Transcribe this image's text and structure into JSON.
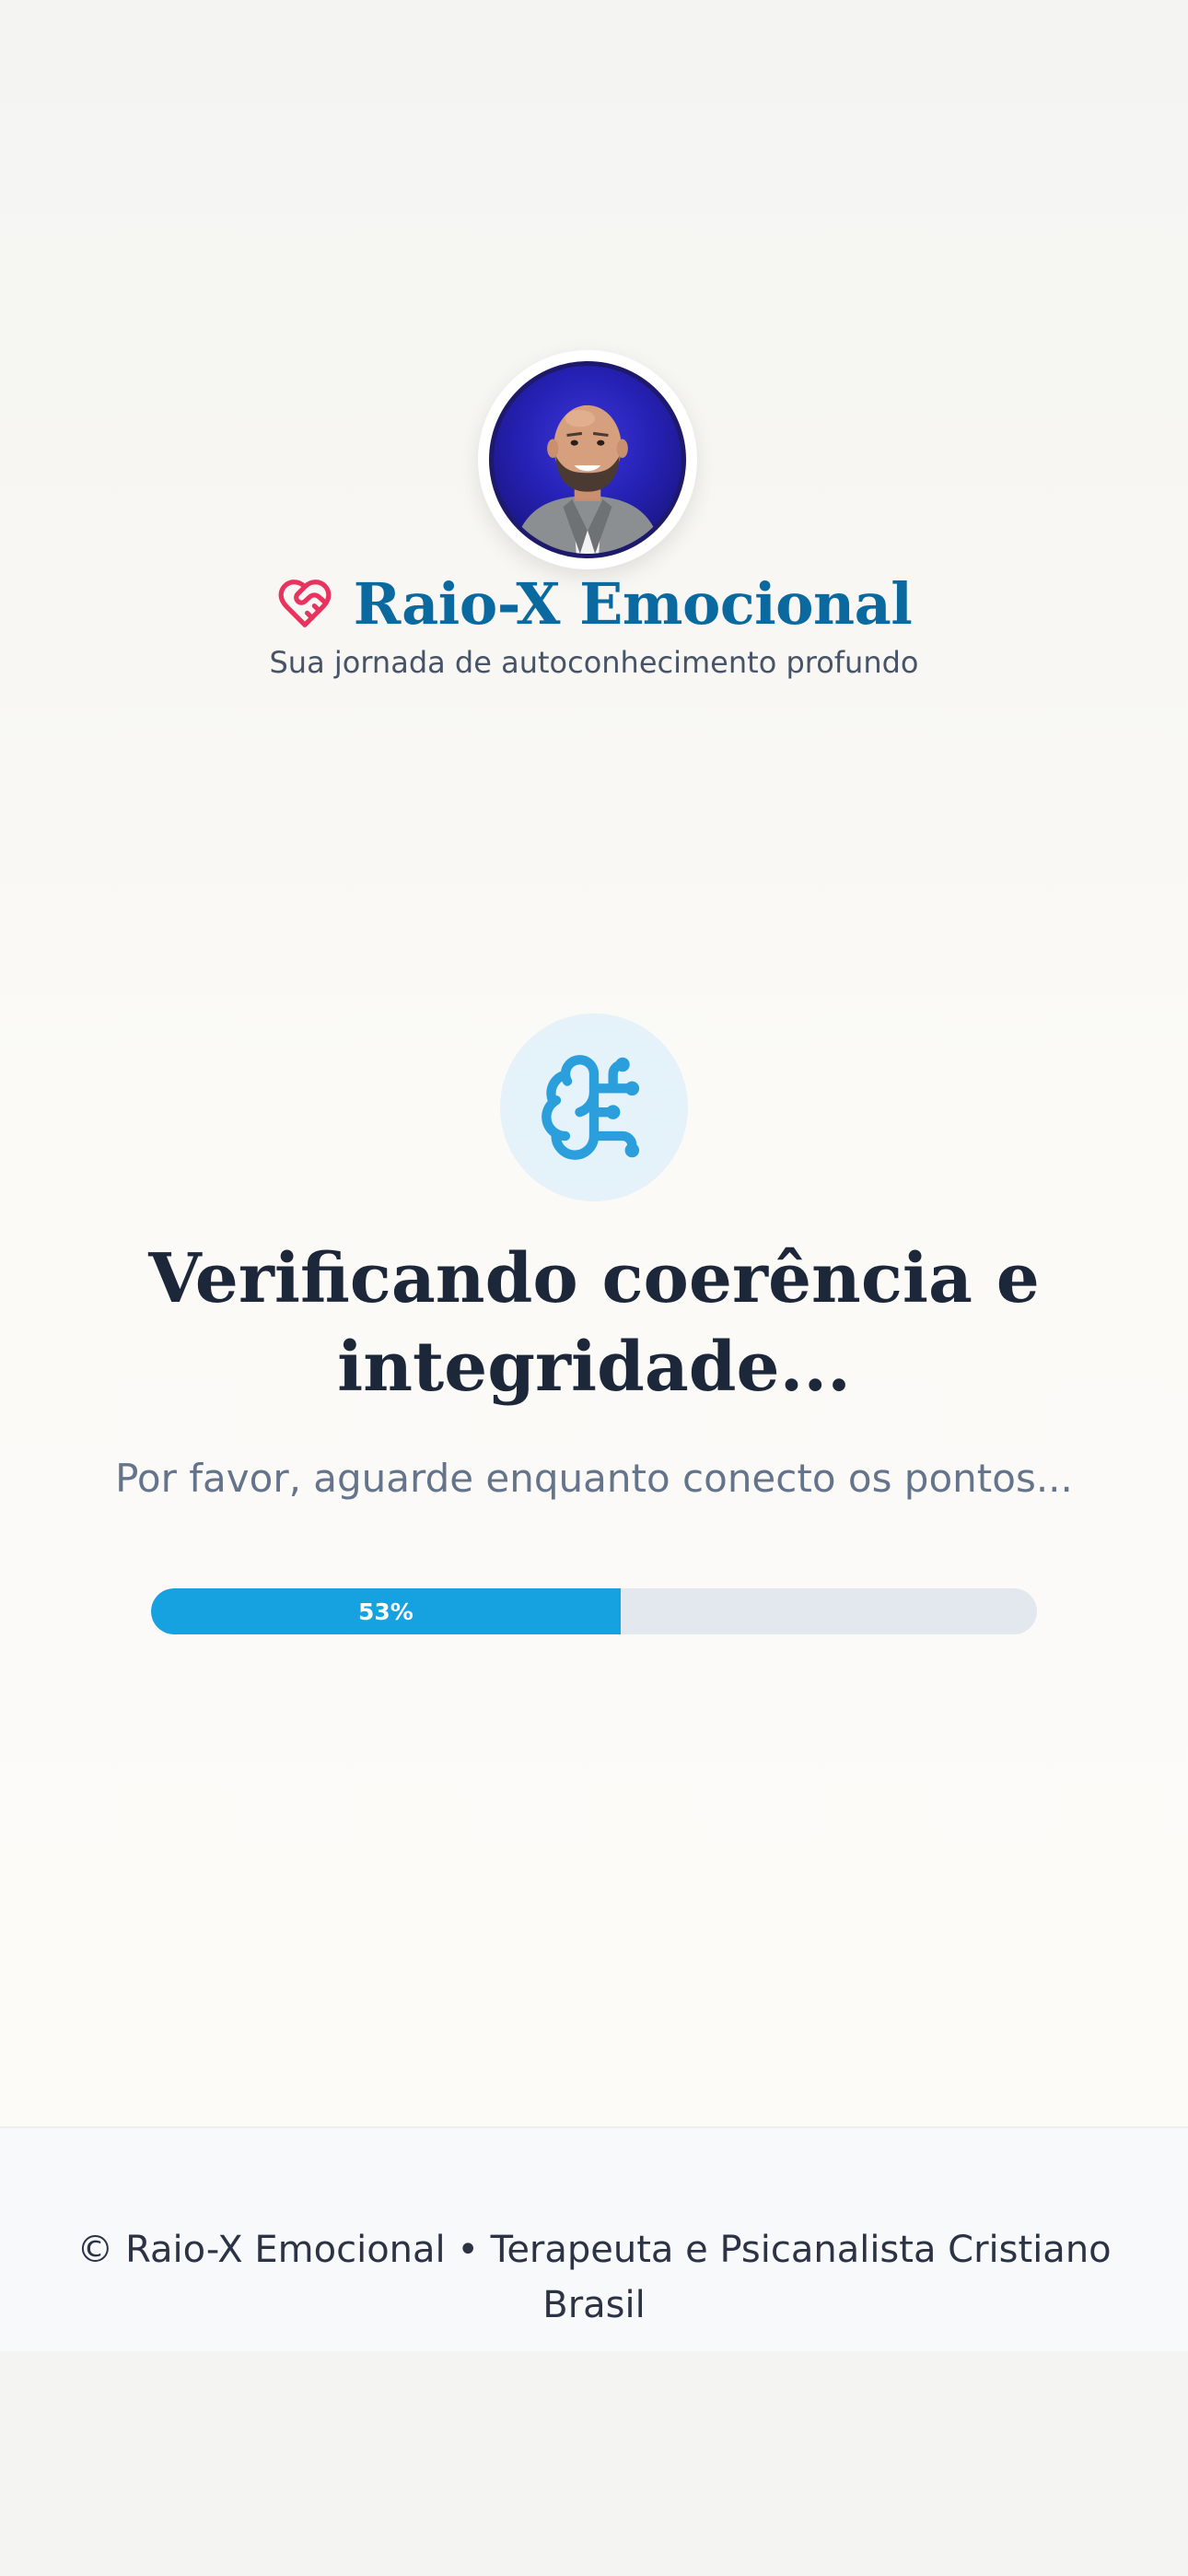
{
  "header": {
    "brand_title": "Raio-X Emocional",
    "tagline": "Sua jornada de autoconhecimento profundo",
    "brand_icon": "heart-handshake-icon",
    "avatar": "profile-photo"
  },
  "main": {
    "status_icon": "brain-circuit-icon",
    "heading": "Verificando coerência e integridade...",
    "subtext": "Por favor, aguarde enquanto conecto os pontos...",
    "progress": {
      "value": 53,
      "label": "53%"
    }
  },
  "footer": {
    "text": "© Raio-X Emocional • Terapeuta e Psicanalista Cristiano Brasil"
  },
  "colors": {
    "brand": "#0a6aa0",
    "heart": "#e8335f",
    "accent": "#16a1e0",
    "heading": "#1c2739",
    "muted": "#64748b",
    "track": "#e3e8ef"
  }
}
